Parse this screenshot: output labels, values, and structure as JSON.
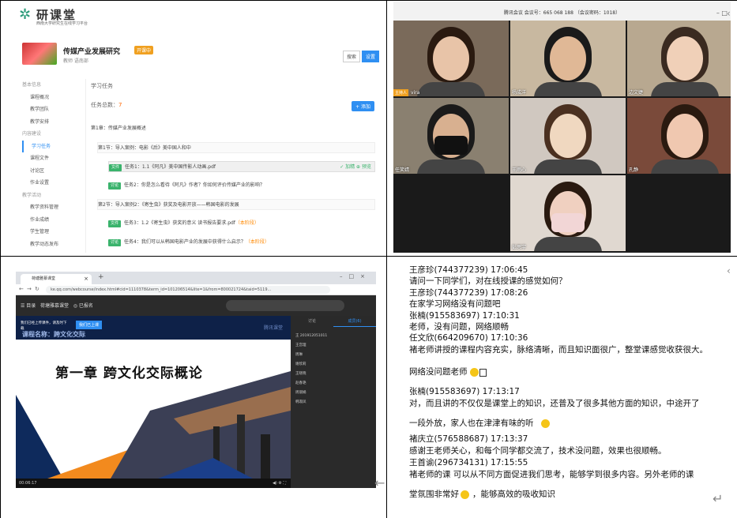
{
  "q1": {
    "logo_text": "研课堂",
    "logo_sub": "西南大学研究生在线学习平台",
    "course_title": "传媒产业发展研究",
    "course_badge": "开课中",
    "course_meta": "教师  语南部",
    "course_btns": [
      "搜索",
      "设置"
    ],
    "sidebar": [
      {
        "type": "group",
        "label": "基本信息"
      },
      {
        "type": "item",
        "label": "课程概况"
      },
      {
        "type": "item",
        "label": "教学团队"
      },
      {
        "type": "item",
        "label": "教学安排"
      },
      {
        "type": "group",
        "label": "内容建设"
      },
      {
        "type": "item",
        "label": "学习任务",
        "active": true
      },
      {
        "type": "item",
        "label": "课程文件"
      },
      {
        "type": "item",
        "label": "讨论区"
      },
      {
        "type": "item",
        "label": "作业设置"
      },
      {
        "type": "group",
        "label": "教学活动"
      },
      {
        "type": "item",
        "label": "教学资料管理"
      },
      {
        "type": "item",
        "label": "作业成绩"
      },
      {
        "type": "item",
        "label": "学生管理"
      },
      {
        "type": "item",
        "label": "教学动态发布"
      }
    ],
    "main_header": "学习任务",
    "task_count_label": "任务总数：",
    "task_count": "7",
    "add_btn": "+ 添加",
    "rows": [
      {
        "text": "第1章：传媒产业发展概述",
        "lvl": 1
      },
      {
        "text": "第1节：导入案例：电影《后》美中国人和中",
        "lvl": 2
      },
      {
        "tag": "文件",
        "text": "任务1：1.1《阿凡》美中国传影人动画.pdf",
        "lvl": 3,
        "actions": "✓ 加精   ⊕ 预览"
      },
      {
        "tag": "讨论",
        "text": "任务2：你是怎么看待《阿凡》作者？你如何评价传媒产业的影响？",
        "lvl": 3
      },
      {
        "text": "第2节：导入案例2：《寄生虫》获奖及电影开放——韩国电影的发展",
        "lvl": 2
      },
      {
        "tag": "文件",
        "text": "任务3：1.2《寄生虫》获奖的意义   读书报告要求.pdf",
        "orange": "（本阶段）",
        "lvl": 3
      },
      {
        "tag": "讨论",
        "text": "任务4：我们可以从韩国电影产业的发展中获得什么启示？",
        "orange": "（本阶段）",
        "lvl": 3
      }
    ]
  },
  "q2": {
    "title": "腾讯会议 会议号：665 068 188 （会议密码：1018）",
    "participants": [
      {
        "name": "vira",
        "host": "主持人"
      },
      {
        "name": "杨成洋"
      },
      {
        "name": "边文婕"
      },
      {
        "name": "任笑婧"
      },
      {
        "name": "王雨心"
      },
      {
        "name": "孔静"
      },
      {
        "name": "彭思宇"
      }
    ]
  },
  "q3": {
    "tab_title": "荷塘雅慕课堂",
    "url": "ke.qq.com/webcourse/index.html#cid=1110378&term_id=101206514&lite=1&from=800021724&taid=5119...",
    "menu": [
      "☰ 目录",
      "荷塘雅慕课堂",
      "◎ 已报名"
    ],
    "notice": "我们已经上传课件，请及时下载",
    "notice_btn": "我们已上课",
    "watermark": "腾讯课堂",
    "slide_title": "第一章  跨文化交际概论",
    "slide_banner": "课程名称：跨文化交际",
    "time": "00:06:17",
    "chat_tabs": [
      "讨论",
      "成员(6)"
    ],
    "chat_members": [
      "王 201912051011",
      "王宫理",
      "周琳",
      "谢欣莉",
      "王晓晓",
      "赵春艳",
      "周丽娟",
      "韩淑凤"
    ]
  },
  "q4": {
    "lines": [
      "王彦珍(744377239)    17:06:45",
      "请问一下同学们，对在线授课的感觉如何？",
      "王彦珍(744377239)    17:08:26",
      "在家学习网络没有问题吧",
      "张楠(915583697)     17:10:31",
      "老师，没有问题，网络顺畅",
      "任文欣(664209670)    17:10:36",
      "褚老师讲授的课程内容充实，脉络清晰，而且知识面很广，整堂课感觉收获很大。",
      "网络没问题老师",
      "张楠(915583697)     17:13:17",
      "对，而且讲的不仅仅是课堂上的知识，还普及了很多其他方面的知识，中途开了",
      "一段外放，家人也在津津有味的听",
      "褚庆立(576588687)    17:13:37",
      "感谢王老师关心，和每个同学都交流了，技术没问题，效果也很顺畅。",
      "王首谕(296734131)    17:15:55",
      "褚老师的课  可以从不同方面促进我们思考，能够学到很多内容。另外老师的课",
      "堂氛围非常好",
      "，能够高效的吸收知识"
    ]
  }
}
